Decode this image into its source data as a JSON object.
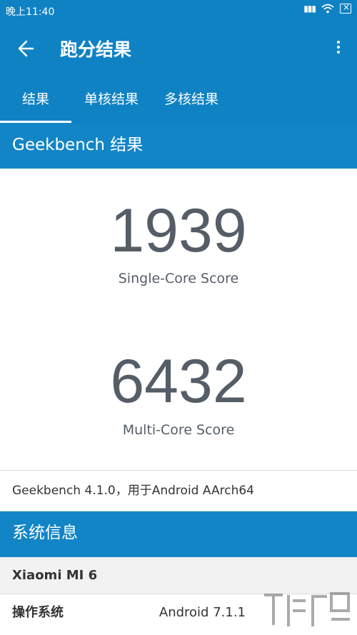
{
  "status_bar": {
    "time": "晚上11:40"
  },
  "app_bar": {
    "title": "跑分结果"
  },
  "tabs": [
    {
      "label": "结果",
      "active": true
    },
    {
      "label": "单核结果",
      "active": false
    },
    {
      "label": "多核结果",
      "active": false
    }
  ],
  "results": {
    "header": "Geekbench 结果",
    "single_core": {
      "value": "1939",
      "label": "Single-Core Score"
    },
    "multi_core": {
      "value": "6432",
      "label": "Multi-Core Score"
    },
    "version_line": "Geekbench 4.1.0，用于Android AArch64"
  },
  "system_info": {
    "header": "系统信息",
    "device": "Xiaomi MI 6",
    "os_key": "操作系统",
    "os_value": "Android 7.1.1"
  },
  "colors": {
    "primary": "#0f82c4",
    "score_text": "#555d66"
  },
  "icons": [
    "back-arrow-icon",
    "more-vert-icon",
    "wifi-icon",
    "battery-icon",
    "signal-icon"
  ]
}
